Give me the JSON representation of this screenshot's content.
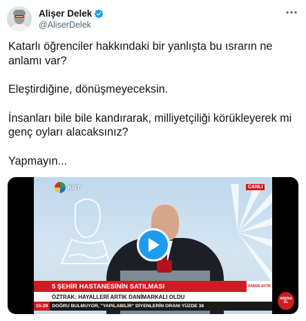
{
  "user": {
    "display_name": "Alişer Delek",
    "handle": "@AliserDelek",
    "verified": true,
    "verified_icon": "verified-badge-icon",
    "avatar_icon": "profile-avatar"
  },
  "tweet": {
    "paragraphs": [
      "Katarlı öğrenciler hakkındaki bir yanlışta bu ısrarın ne anlamı var?",
      "Eleştirdiğine, dönüşmeyeceksin.",
      "İnsanları bile bile kandırarak, milliyetçiliği körükleyerek mi genç oyları alacaksınız?",
      "Yapmayın..."
    ]
  },
  "video": {
    "channel_logo_text": "KRT",
    "live_badge": "CANLI",
    "headline": "5 ŞEHİR HASTANESİNİN SATILMASI",
    "subheadline": "ÖZTRAK: HAYALLERİ ARTIK DANİMARKALI OLDU",
    "program_tag": "HABER AKTİF",
    "ticker_time": "15:29",
    "ticker_text": "DOĞRU BULMUYOR, \"YAPILABILİR\" DİYENLERİN ORANI YÜZDE 38",
    "corner_badge": "ARENA OL",
    "play_icon": "play-icon"
  },
  "colors": {
    "accent": "#1d9bf0",
    "text": "#0f1419",
    "secondary_text": "#536471",
    "news_red": "#cf1b23"
  }
}
